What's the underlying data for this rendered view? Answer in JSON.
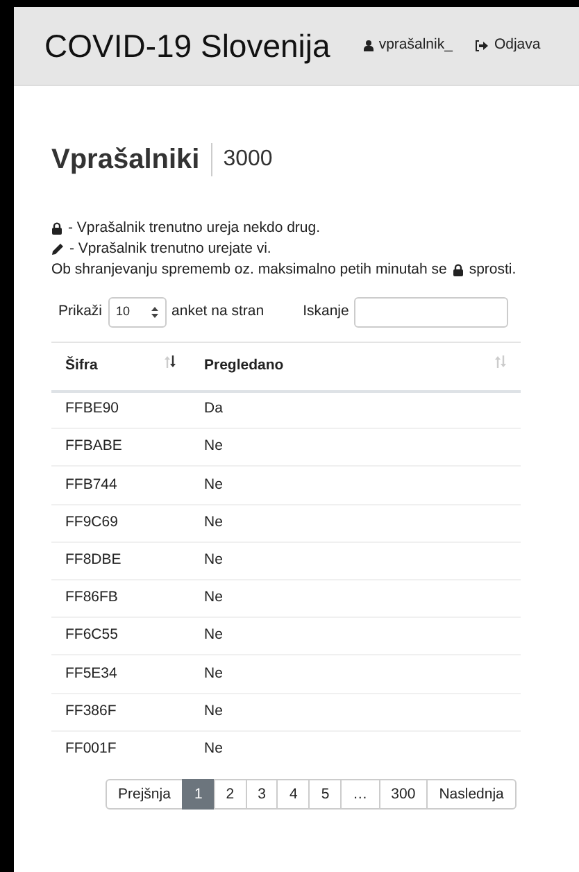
{
  "navbar": {
    "brand": "COVID-19 Slovenija",
    "user": "vprašalnik_",
    "logout": "Odjava"
  },
  "heading": {
    "title": "Vprašalniki",
    "count": "3000"
  },
  "legend": [
    {
      "kind": "lock",
      "text": "- Vprašalnik trenutno ureja nekdo drug."
    },
    {
      "kind": "pencil",
      "text": "- Vprašalnik trenutno urejate vi."
    },
    {
      "parts": [
        "Ob shranjevanju sprememb oz. maksimalno petih minutah se",
        "sprosti."
      ]
    }
  ],
  "length": {
    "label_before": "Prikaži",
    "value": "10",
    "label_after": "anket na stran"
  },
  "search": {
    "label": "Iskanje"
  },
  "table": {
    "columns": [
      {
        "label": "Šifra",
        "sorted": true
      },
      {
        "label": "Pregledano",
        "sorted": false
      }
    ],
    "rows": [
      [
        "FFBE90",
        "Da"
      ],
      [
        "FFBABE",
        "Ne"
      ],
      [
        "FFB744",
        "Ne"
      ],
      [
        "FF9C69",
        "Ne"
      ],
      [
        "FF8DBE",
        "Ne"
      ],
      [
        "FF86FB",
        "Ne"
      ],
      [
        "FF6C55",
        "Ne"
      ],
      [
        "FF5E34",
        "Ne"
      ],
      [
        "FF386F",
        "Ne"
      ],
      [
        "FF001F",
        "Ne"
      ]
    ]
  },
  "pagination": [
    {
      "label": "Prejšnja",
      "selected": false
    },
    {
      "label": "1",
      "selected": true
    },
    {
      "label": "2",
      "selected": false
    },
    {
      "label": "3",
      "selected": false
    },
    {
      "label": "4",
      "selected": false
    },
    {
      "label": "5",
      "selected": false
    },
    {
      "label": "…",
      "selected": false
    },
    {
      "label": "300",
      "selected": false
    },
    {
      "label": "Naslednja",
      "selected": false
    }
  ]
}
